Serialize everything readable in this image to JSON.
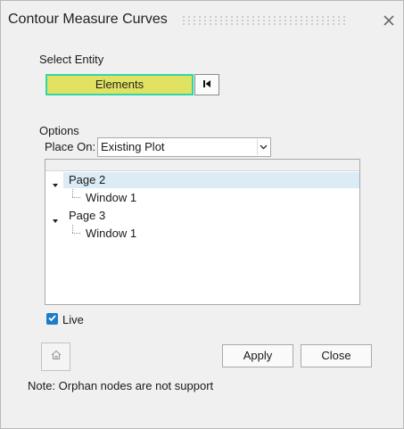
{
  "window": {
    "title": "Contour Measure Curves"
  },
  "select_entity": {
    "label": "Select Entity",
    "button_label": "Elements"
  },
  "options": {
    "label": "Options",
    "place_on_label": "Place On:",
    "place_on_value": "Existing Plot"
  },
  "tree": {
    "items": [
      {
        "label": "Page 2",
        "level": 0,
        "expanded": true,
        "selected": true
      },
      {
        "label": "Window 1",
        "level": 1
      },
      {
        "label": "Page 3",
        "level": 0,
        "expanded": true,
        "selected": false
      },
      {
        "label": "Window 1",
        "level": 1
      }
    ]
  },
  "live": {
    "label": "Live",
    "checked": true
  },
  "buttons": {
    "apply": "Apply",
    "close": "Close"
  },
  "note": "Note: Orphan nodes are not support",
  "colors": {
    "entity_button_fill": "#e2e262",
    "entity_button_border": "#2fd6a8",
    "selection": "#dcecf7",
    "checkbox": "#1e7cc7"
  },
  "icons": {
    "close": "close-icon",
    "reset": "skip-back-icon",
    "dropdown": "chevron-down-icon",
    "expand": "caret-down-icon",
    "check": "check-icon",
    "home": "home-icon"
  }
}
